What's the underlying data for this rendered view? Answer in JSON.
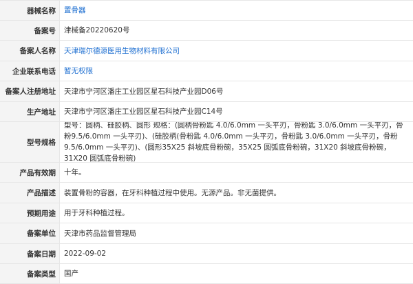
{
  "colors": {
    "label_bg": "#f4f4f4",
    "border": "#e6e6e6",
    "link": "#1e6fd1",
    "text": "#333333"
  },
  "rows": [
    {
      "label": "器械名称",
      "value": "置骨器"
    },
    {
      "label": "备案号",
      "value": "津械备20220620号"
    },
    {
      "label": "备案人名称",
      "value": "天津瑞尔德源医用生物材料有限公司"
    },
    {
      "label": "企业联系电话",
      "value": "暂无权限"
    },
    {
      "label": "备案人注册地址",
      "value": "天津市宁河区潘庄工业园区星石科技产业园D06号"
    },
    {
      "label": "生产地址",
      "value": "天津市宁河区潘庄工业园区星石科技产业园C14号"
    },
    {
      "label": "型号规格",
      "value": "型号：圆柄、硅胶柄、圆形 规格：(圆柄骨粉匙 4.0/6.0mm 一头平刃，骨粉匙 3.0/6.0mm 一头平刃，骨粉9.5/6.0mm 一头平刃)、(硅胶柄(骨粉匙 4.0/6.0mm 一头平刃，骨粉匙 3.0/6.0mm 一头平刃，骨粉9.5/6.0mm 一头平刃)、(圆形35X25 斜坡底骨粉碗，35X25 圆弧底骨粉碗，31X20 斜坡底骨粉碗，31X20 圆弧底骨粉碗)"
    },
    {
      "label": "产品有效期",
      "value": "十年。"
    },
    {
      "label": "产品描述",
      "value": "装置骨粉的容器，在牙科种植过程中使用。无源产品。非无菌提供。"
    },
    {
      "label": "预期用途",
      "value": "用于牙科种植过程。"
    },
    {
      "label": "备案单位",
      "value": "天津市药品监督管理局"
    },
    {
      "label": "备案日期",
      "value": "2022-09-02"
    },
    {
      "label": "备案类型",
      "value": "国产"
    }
  ]
}
